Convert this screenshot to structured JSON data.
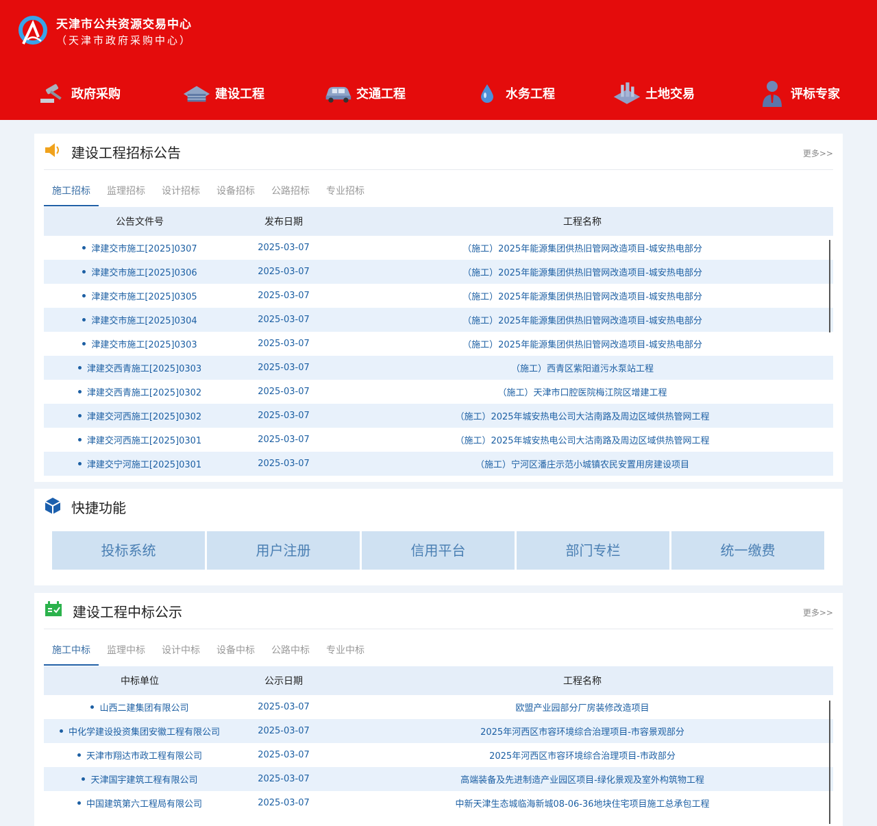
{
  "brand": {
    "title": "天津市公共资源交易中心",
    "subtitle": "（天津市政府采购中心）"
  },
  "nav": [
    {
      "label": "政府采购",
      "icon": "gavel-icon"
    },
    {
      "label": "建设工程",
      "icon": "building-icon"
    },
    {
      "label": "交通工程",
      "icon": "car-icon"
    },
    {
      "label": "水务工程",
      "icon": "water-drop-icon"
    },
    {
      "label": "土地交易",
      "icon": "land-icon"
    },
    {
      "label": "评标专家",
      "icon": "expert-icon"
    }
  ],
  "tender": {
    "title": "建设工程招标公告",
    "more": "更多>>",
    "tabs": [
      "施工招标",
      "监理招标",
      "设计招标",
      "设备招标",
      "公路招标",
      "专业招标"
    ],
    "headers": [
      "公告文件号",
      "发布日期",
      "工程名称"
    ],
    "rows": [
      [
        "津建交市施工[2025]0307",
        "2025-03-07",
        "（施工）2025年能源集团供热旧管网改造项目-城安热电部分"
      ],
      [
        "津建交市施工[2025]0306",
        "2025-03-07",
        "（施工）2025年能源集团供热旧管网改造项目-城安热电部分"
      ],
      [
        "津建交市施工[2025]0305",
        "2025-03-07",
        "（施工）2025年能源集团供热旧管网改造项目-城安热电部分"
      ],
      [
        "津建交市施工[2025]0304",
        "2025-03-07",
        "（施工）2025年能源集团供热旧管网改造项目-城安热电部分"
      ],
      [
        "津建交市施工[2025]0303",
        "2025-03-07",
        "（施工）2025年能源集团供热旧管网改造项目-城安热电部分"
      ],
      [
        "津建交西青施工[2025]0303",
        "2025-03-07",
        "（施工）西青区紫阳道污水泵站工程"
      ],
      [
        "津建交西青施工[2025]0302",
        "2025-03-07",
        "（施工）天津市口腔医院梅江院区增建工程"
      ],
      [
        "津建交河西施工[2025]0302",
        "2025-03-07",
        "（施工）2025年城安热电公司大沽南路及周边区域供热管网工程"
      ],
      [
        "津建交河西施工[2025]0301",
        "2025-03-07",
        "（施工）2025年城安热电公司大沽南路及周边区域供热管网工程"
      ],
      [
        "津建交宁河施工[2025]0301",
        "2025-03-07",
        "（施工）宁河区潘庄示范小城镇农民安置用房建设项目"
      ]
    ]
  },
  "quick": {
    "title": "快捷功能",
    "buttons": [
      "投标系统",
      "用户注册",
      "信用平台",
      "部门专栏",
      "统一缴费"
    ]
  },
  "award": {
    "title": "建设工程中标公示",
    "more": "更多>>",
    "tabs": [
      "施工中标",
      "监理中标",
      "设计中标",
      "设备中标",
      "公路中标",
      "专业中标"
    ],
    "headers": [
      "中标单位",
      "公示日期",
      "工程名称"
    ],
    "rows": [
      [
        "山西二建集团有限公司",
        "2025-03-07",
        "欧盟产业园部分厂房装修改造项目"
      ],
      [
        "中化学建设投资集团安徽工程有限公司",
        "2025-03-07",
        "2025年河西区市容环境综合治理项目-市容景观部分"
      ],
      [
        "天津市翔达市政工程有限公司",
        "2025-03-07",
        "2025年河西区市容环境综合治理项目-市政部分"
      ],
      [
        "天津国宇建筑工程有限公司",
        "2025-03-07",
        "高端装备及先进制造产业园区项目-绿化景观及室外构筑物工程"
      ],
      [
        "中国建筑第六工程局有限公司",
        "2025-03-07",
        "中新天津生态城临海新城08-06-36地块住宅项目施工总承包工程"
      ]
    ]
  }
}
